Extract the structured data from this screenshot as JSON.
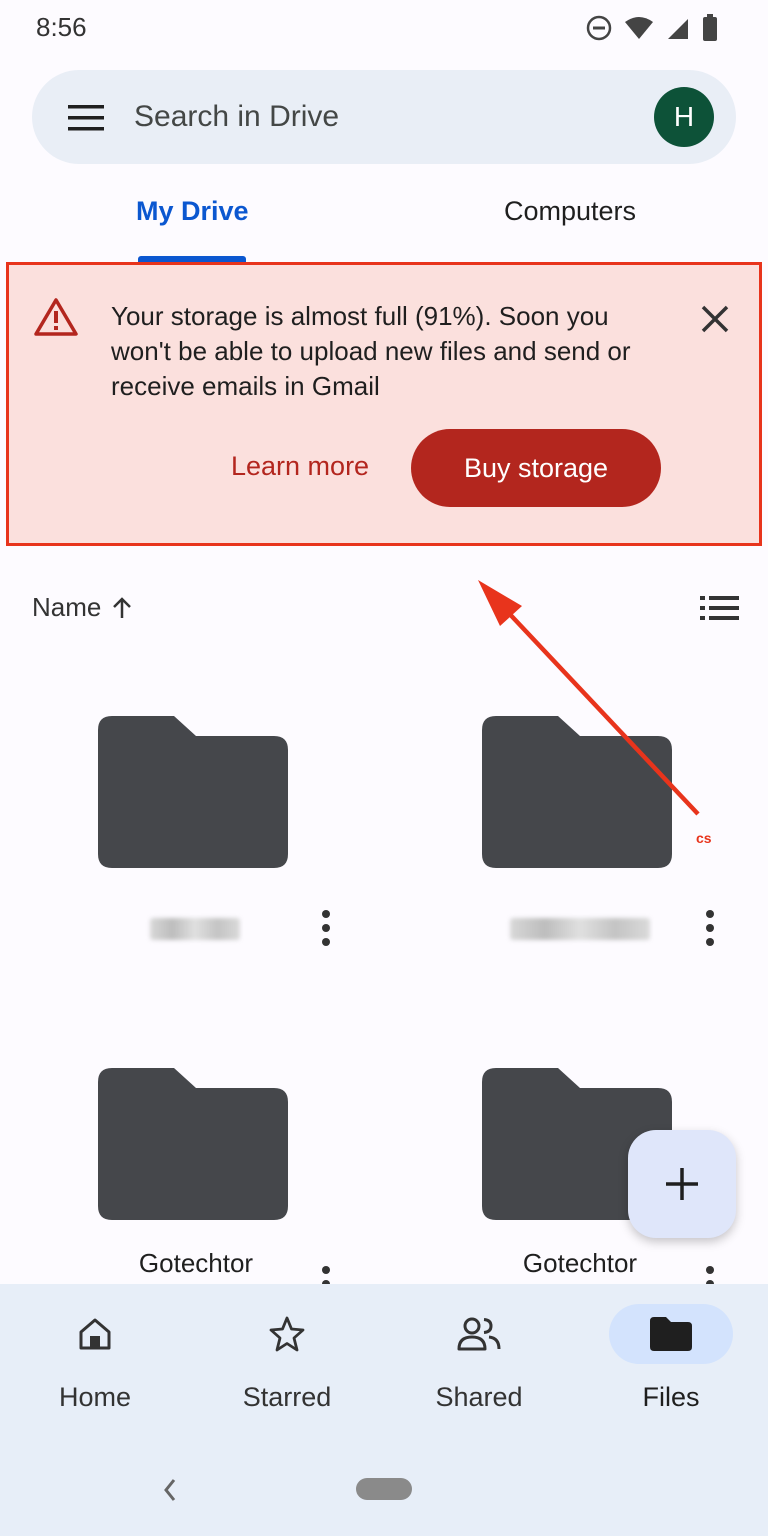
{
  "status_bar": {
    "time": "8:56"
  },
  "search": {
    "placeholder": "Search in Drive",
    "avatar_initial": "H"
  },
  "tabs": [
    {
      "label": "My Drive",
      "active": true
    },
    {
      "label": "Computers",
      "active": false
    }
  ],
  "banner": {
    "message": "Your storage is almost full (91%). Soon you won't be able to upload new files and send or receive emails in Gmail",
    "storage_used_percent": 91,
    "learn_more_label": "Learn more",
    "buy_storage_label": "Buy storage"
  },
  "sort": {
    "label": "Name"
  },
  "folders": [
    {
      "name": ""
    },
    {
      "name": ""
    },
    {
      "name": "Gotechtor"
    },
    {
      "name": "Gotechtor"
    }
  ],
  "annotation": {
    "watermark": "cs"
  },
  "bottom_nav": {
    "items": [
      {
        "label": "Home",
        "icon": "home-icon",
        "active": false
      },
      {
        "label": "Starred",
        "icon": "star-icon",
        "active": false
      },
      {
        "label": "Shared",
        "icon": "people-icon",
        "active": false
      },
      {
        "label": "Files",
        "icon": "folder-icon",
        "active": true
      }
    ]
  },
  "colors": {
    "accent": "#0b57d0",
    "warning_bg": "#fbe0dd",
    "warning_red": "#b3261e",
    "annotation_red": "#e8341c",
    "folder": "#45474b"
  }
}
